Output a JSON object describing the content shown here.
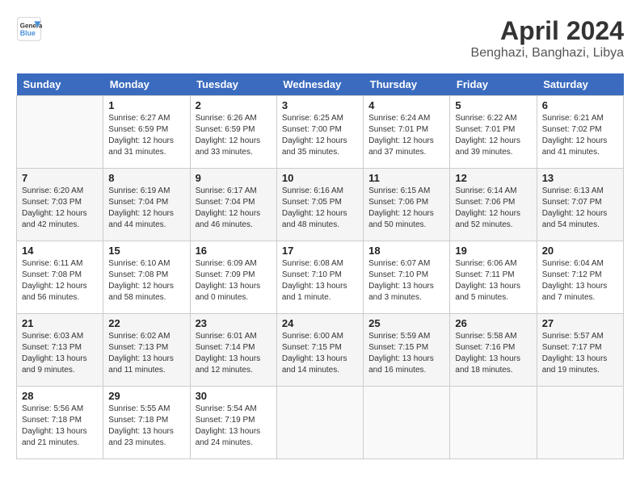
{
  "header": {
    "logo_line1": "General",
    "logo_line2": "Blue",
    "month_title": "April 2024",
    "location": "Benghazi, Banghazi, Libya"
  },
  "days_of_week": [
    "Sunday",
    "Monday",
    "Tuesday",
    "Wednesday",
    "Thursday",
    "Friday",
    "Saturday"
  ],
  "weeks": [
    [
      {
        "day": "",
        "info": ""
      },
      {
        "day": "1",
        "info": "Sunrise: 6:27 AM\nSunset: 6:59 PM\nDaylight: 12 hours\nand 31 minutes."
      },
      {
        "day": "2",
        "info": "Sunrise: 6:26 AM\nSunset: 6:59 PM\nDaylight: 12 hours\nand 33 minutes."
      },
      {
        "day": "3",
        "info": "Sunrise: 6:25 AM\nSunset: 7:00 PM\nDaylight: 12 hours\nand 35 minutes."
      },
      {
        "day": "4",
        "info": "Sunrise: 6:24 AM\nSunset: 7:01 PM\nDaylight: 12 hours\nand 37 minutes."
      },
      {
        "day": "5",
        "info": "Sunrise: 6:22 AM\nSunset: 7:01 PM\nDaylight: 12 hours\nand 39 minutes."
      },
      {
        "day": "6",
        "info": "Sunrise: 6:21 AM\nSunset: 7:02 PM\nDaylight: 12 hours\nand 41 minutes."
      }
    ],
    [
      {
        "day": "7",
        "info": "Sunrise: 6:20 AM\nSunset: 7:03 PM\nDaylight: 12 hours\nand 42 minutes."
      },
      {
        "day": "8",
        "info": "Sunrise: 6:19 AM\nSunset: 7:04 PM\nDaylight: 12 hours\nand 44 minutes."
      },
      {
        "day": "9",
        "info": "Sunrise: 6:17 AM\nSunset: 7:04 PM\nDaylight: 12 hours\nand 46 minutes."
      },
      {
        "day": "10",
        "info": "Sunrise: 6:16 AM\nSunset: 7:05 PM\nDaylight: 12 hours\nand 48 minutes."
      },
      {
        "day": "11",
        "info": "Sunrise: 6:15 AM\nSunset: 7:06 PM\nDaylight: 12 hours\nand 50 minutes."
      },
      {
        "day": "12",
        "info": "Sunrise: 6:14 AM\nSunset: 7:06 PM\nDaylight: 12 hours\nand 52 minutes."
      },
      {
        "day": "13",
        "info": "Sunrise: 6:13 AM\nSunset: 7:07 PM\nDaylight: 12 hours\nand 54 minutes."
      }
    ],
    [
      {
        "day": "14",
        "info": "Sunrise: 6:11 AM\nSunset: 7:08 PM\nDaylight: 12 hours\nand 56 minutes."
      },
      {
        "day": "15",
        "info": "Sunrise: 6:10 AM\nSunset: 7:08 PM\nDaylight: 12 hours\nand 58 minutes."
      },
      {
        "day": "16",
        "info": "Sunrise: 6:09 AM\nSunset: 7:09 PM\nDaylight: 13 hours\nand 0 minutes."
      },
      {
        "day": "17",
        "info": "Sunrise: 6:08 AM\nSunset: 7:10 PM\nDaylight: 13 hours\nand 1 minute."
      },
      {
        "day": "18",
        "info": "Sunrise: 6:07 AM\nSunset: 7:10 PM\nDaylight: 13 hours\nand 3 minutes."
      },
      {
        "day": "19",
        "info": "Sunrise: 6:06 AM\nSunset: 7:11 PM\nDaylight: 13 hours\nand 5 minutes."
      },
      {
        "day": "20",
        "info": "Sunrise: 6:04 AM\nSunset: 7:12 PM\nDaylight: 13 hours\nand 7 minutes."
      }
    ],
    [
      {
        "day": "21",
        "info": "Sunrise: 6:03 AM\nSunset: 7:13 PM\nDaylight: 13 hours\nand 9 minutes."
      },
      {
        "day": "22",
        "info": "Sunrise: 6:02 AM\nSunset: 7:13 PM\nDaylight: 13 hours\nand 11 minutes."
      },
      {
        "day": "23",
        "info": "Sunrise: 6:01 AM\nSunset: 7:14 PM\nDaylight: 13 hours\nand 12 minutes."
      },
      {
        "day": "24",
        "info": "Sunrise: 6:00 AM\nSunset: 7:15 PM\nDaylight: 13 hours\nand 14 minutes."
      },
      {
        "day": "25",
        "info": "Sunrise: 5:59 AM\nSunset: 7:15 PM\nDaylight: 13 hours\nand 16 minutes."
      },
      {
        "day": "26",
        "info": "Sunrise: 5:58 AM\nSunset: 7:16 PM\nDaylight: 13 hours\nand 18 minutes."
      },
      {
        "day": "27",
        "info": "Sunrise: 5:57 AM\nSunset: 7:17 PM\nDaylight: 13 hours\nand 19 minutes."
      }
    ],
    [
      {
        "day": "28",
        "info": "Sunrise: 5:56 AM\nSunset: 7:18 PM\nDaylight: 13 hours\nand 21 minutes."
      },
      {
        "day": "29",
        "info": "Sunrise: 5:55 AM\nSunset: 7:18 PM\nDaylight: 13 hours\nand 23 minutes."
      },
      {
        "day": "30",
        "info": "Sunrise: 5:54 AM\nSunset: 7:19 PM\nDaylight: 13 hours\nand 24 minutes."
      },
      {
        "day": "",
        "info": ""
      },
      {
        "day": "",
        "info": ""
      },
      {
        "day": "",
        "info": ""
      },
      {
        "day": "",
        "info": ""
      }
    ]
  ]
}
